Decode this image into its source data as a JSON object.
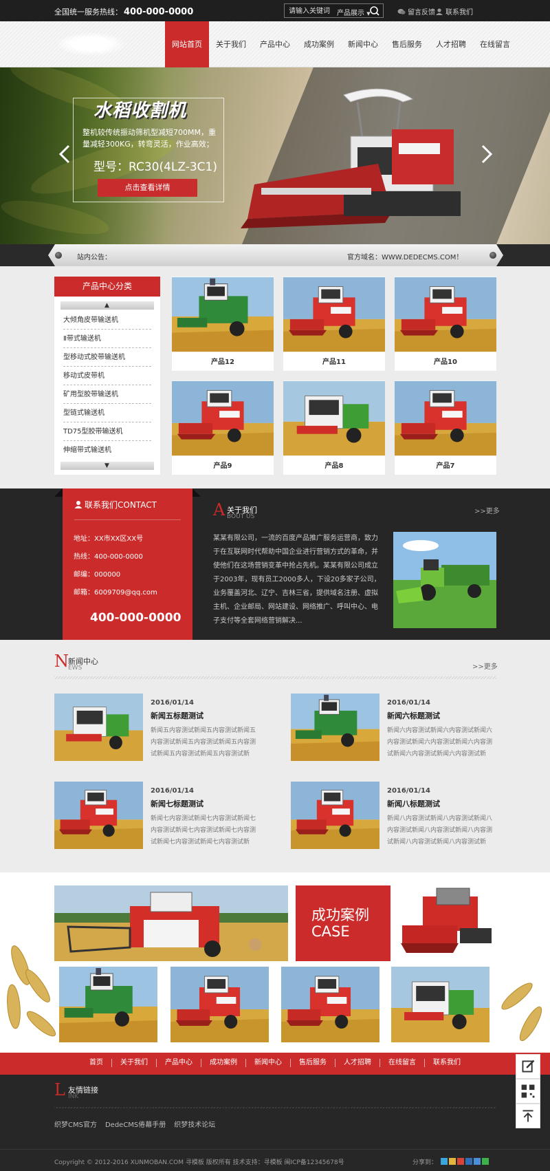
{
  "topbar": {
    "hotline_label": "全国统一服务热线：",
    "hotline_number": "400-000-0000",
    "search_placeholder": "请输入关键词",
    "search_scope": "产品展示",
    "feedback": "留言反馈",
    "contact": "联系我们"
  },
  "nav": {
    "items": [
      "网站首页",
      "关于我们",
      "产品中心",
      "成功案例",
      "新闻中心",
      "售后服务",
      "人才招聘",
      "在线留言"
    ],
    "active_index": 0
  },
  "banner": {
    "title": "水稻收割机",
    "desc": "整机较传统振动筛机型减短700MM，重量减轻300KG，转弯灵活，作业高效；",
    "model": "型号：RC30(4LZ-3C1)",
    "button": "点击查看详情"
  },
  "notice": {
    "label": "站内公告：",
    "domain": "官方域名：WWW.DEDECMS.COM！"
  },
  "product_cat": {
    "title": "产品中心分类",
    "items": [
      "大倾角皮带输送机",
      "Ⅱ带式输送机",
      "型移动式胶带输送机",
      "移动式皮带机",
      "矿用型胶带输送机",
      "型链式输送机",
      "TD75型胶带输送机",
      "伸缩带式输送机"
    ]
  },
  "products": [
    "产品12",
    "产品11",
    "产品10",
    "产品9",
    "产品8",
    "产品7"
  ],
  "contact": {
    "title": "联系我们CONTACT",
    "address": "地址：XX市XX区XX号",
    "hotline": "热线：400-000-0000",
    "postcode": "邮编：000000",
    "email": "邮箱：6009709@qq.com",
    "big_number": "400-000-0000"
  },
  "about": {
    "letter": "A",
    "title": "关于我们",
    "sub": "BOUT US",
    "more": ">>更多",
    "body": "某某有限公司，一流的百度产品推广服务运营商，致力于在互联网时代帮助中国企业进行营销方式的革命，并使他们在这场营销变革中抢占先机。某某有限公司成立于2003年，现有员工2000多人，下设20多家子公司，业务覆盖河北、辽宁、吉林三省，提供域名注册、虚拟主机、企业邮局、网站建设、网络推广、呼叫中心、电子支付等全套网络营销解决..."
  },
  "news": {
    "letter": "N",
    "title": "新闻中心",
    "sub": "EWS",
    "more": ">>更多",
    "items": [
      {
        "date": "2016/01/14",
        "title": "新闻五标题测试",
        "body": "新闻五内容测试新闻五内容测试新闻五内容测试新闻五内容测试新闻五内容测试新闻五内容测试新闻五内容测试新"
      },
      {
        "date": "2016/01/14",
        "title": "新闻六标题测试",
        "body": "新闻六内容测试新闻六内容测试新闻六内容测试新闻六内容测试新闻六内容测试新闻六内容测试新闻六内容测试新"
      },
      {
        "date": "2016/01/14",
        "title": "新闻七标题测试",
        "body": "新闻七内容测试新闻七内容测试新闻七内容测试新闻七内容测试新闻七内容测试新闻七内容测试新闻七内容测试新"
      },
      {
        "date": "2016/01/14",
        "title": "新闻八标题测试",
        "body": "新闻八内容测试新闻八内容测试新闻八内容测试新闻八内容测试新闻八内容测试新闻八内容测试新闻八内容测试新"
      }
    ]
  },
  "case": {
    "title_cn": "成功案例",
    "title_en": "CASE"
  },
  "footer_nav": [
    "首页",
    "关于我们",
    "产品中心",
    "成功案例",
    "新闻中心",
    "售后服务",
    "人才招聘",
    "在线留言",
    "联系我们"
  ],
  "links": {
    "letter": "L",
    "title": "友情链接",
    "sub": "INK",
    "items": [
      "织梦CMS官方",
      "DedeCMS倦幕手册",
      "织梦技术论坛"
    ]
  },
  "copyright": "Copyright © 2012-2016 XUNMOBAN.COM 寻模板 版权所有     技术支持：寻模板     闽ICP备12345678号",
  "share_label": "分享到：",
  "colors": {
    "accent": "#cc2b2b",
    "dark": "#262626"
  }
}
